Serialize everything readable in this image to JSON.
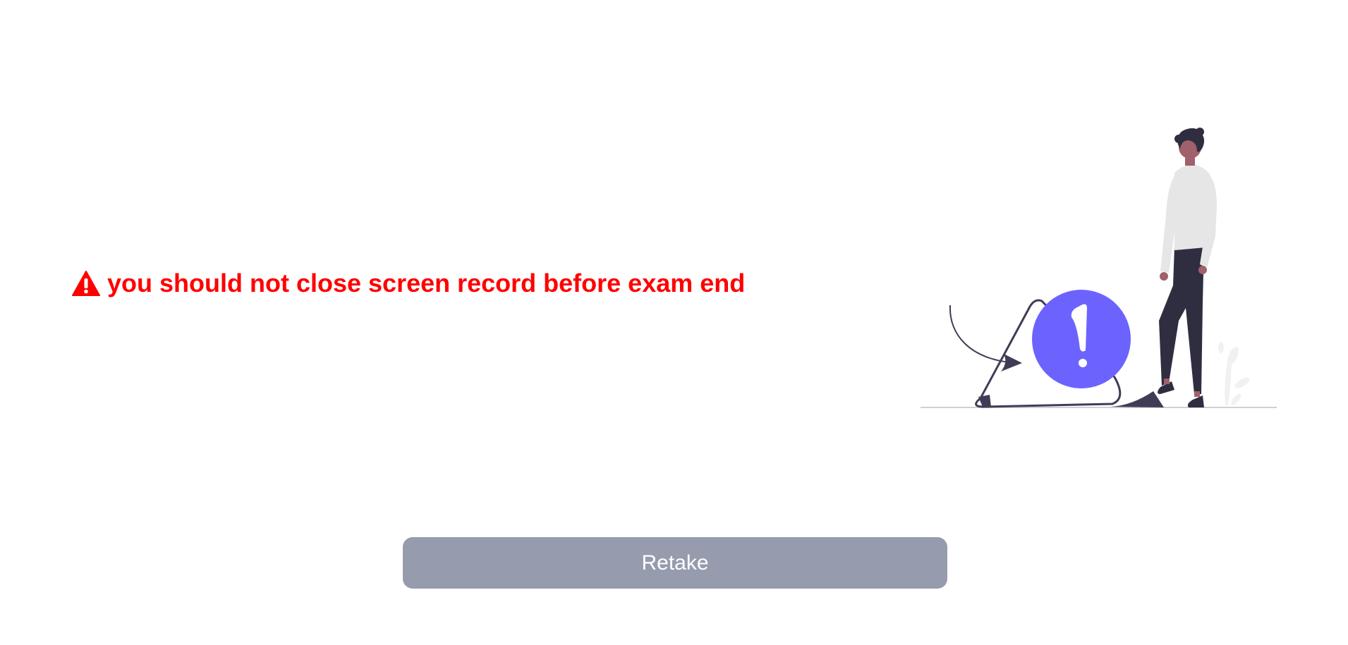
{
  "warning": {
    "icon": "warning-triangle-icon",
    "message": "you should not close screen record before exam end",
    "color": "#ff0000"
  },
  "illustration": {
    "icon": "person-alert-illustration",
    "accent_color": "#6c63ff"
  },
  "actions": {
    "retake_label": "Retake",
    "retake_color": "#969bae"
  }
}
